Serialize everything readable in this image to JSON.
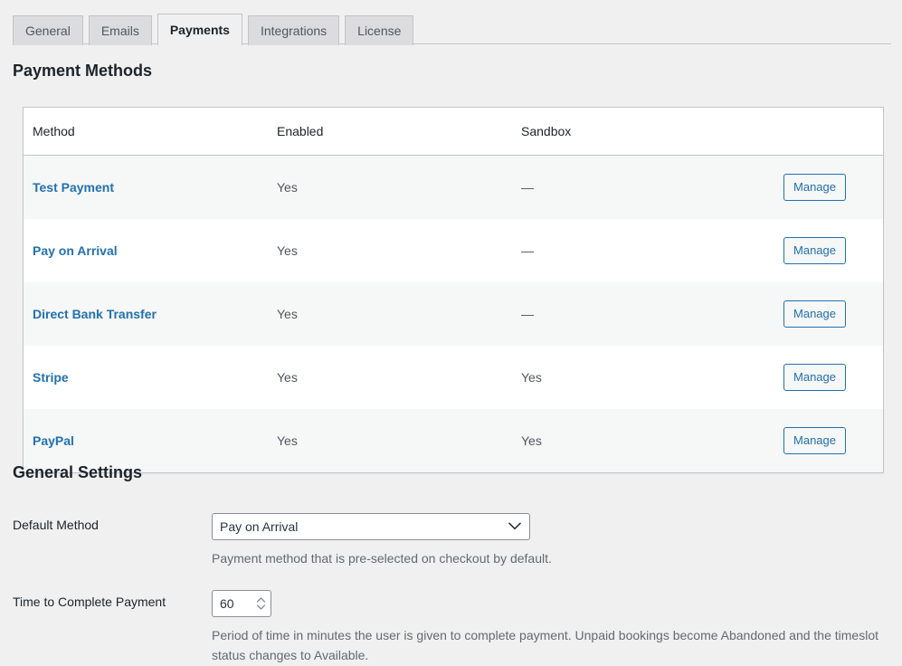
{
  "tabs": [
    {
      "label": "General",
      "active": false
    },
    {
      "label": "Emails",
      "active": false
    },
    {
      "label": "Payments",
      "active": true
    },
    {
      "label": "Integrations",
      "active": false
    },
    {
      "label": "License",
      "active": false
    }
  ],
  "payment_methods_section": {
    "title": "Payment Methods",
    "columns": [
      "Method",
      "Enabled",
      "Sandbox",
      ""
    ],
    "rows": [
      {
        "method": "Test Payment",
        "enabled": "Yes",
        "sandbox": "—",
        "action": "Manage"
      },
      {
        "method": "Pay on Arrival",
        "enabled": "Yes",
        "sandbox": "—",
        "action": "Manage"
      },
      {
        "method": "Direct Bank Transfer",
        "enabled": "Yes",
        "sandbox": "—",
        "action": "Manage"
      },
      {
        "method": "Stripe",
        "enabled": "Yes",
        "sandbox": "Yes",
        "action": "Manage"
      },
      {
        "method": "PayPal",
        "enabled": "Yes",
        "sandbox": "Yes",
        "action": "Manage"
      }
    ]
  },
  "general_settings_section": {
    "title": "General Settings",
    "default_method": {
      "label": "Default Method",
      "value": "Pay on Arrival",
      "options": [
        "Test Payment",
        "Pay on Arrival",
        "Direct Bank Transfer",
        "Stripe",
        "PayPal"
      ],
      "description": "Payment method that is pre-selected on checkout by default."
    },
    "time_to_complete_payment": {
      "label": "Time to Complete Payment",
      "value": "60",
      "description": "Period of time in minutes the user is given to complete payment. Unpaid bookings become Abandoned and the timeslot status changes to Available."
    }
  },
  "colors": {
    "page_bg": "#f0f0f1",
    "link_blue": "#2271b1",
    "border_gray": "#c3c4c7",
    "row_stripe": "#f6f7f7",
    "text_dark": "#1d2327",
    "text_muted": "#646970"
  }
}
